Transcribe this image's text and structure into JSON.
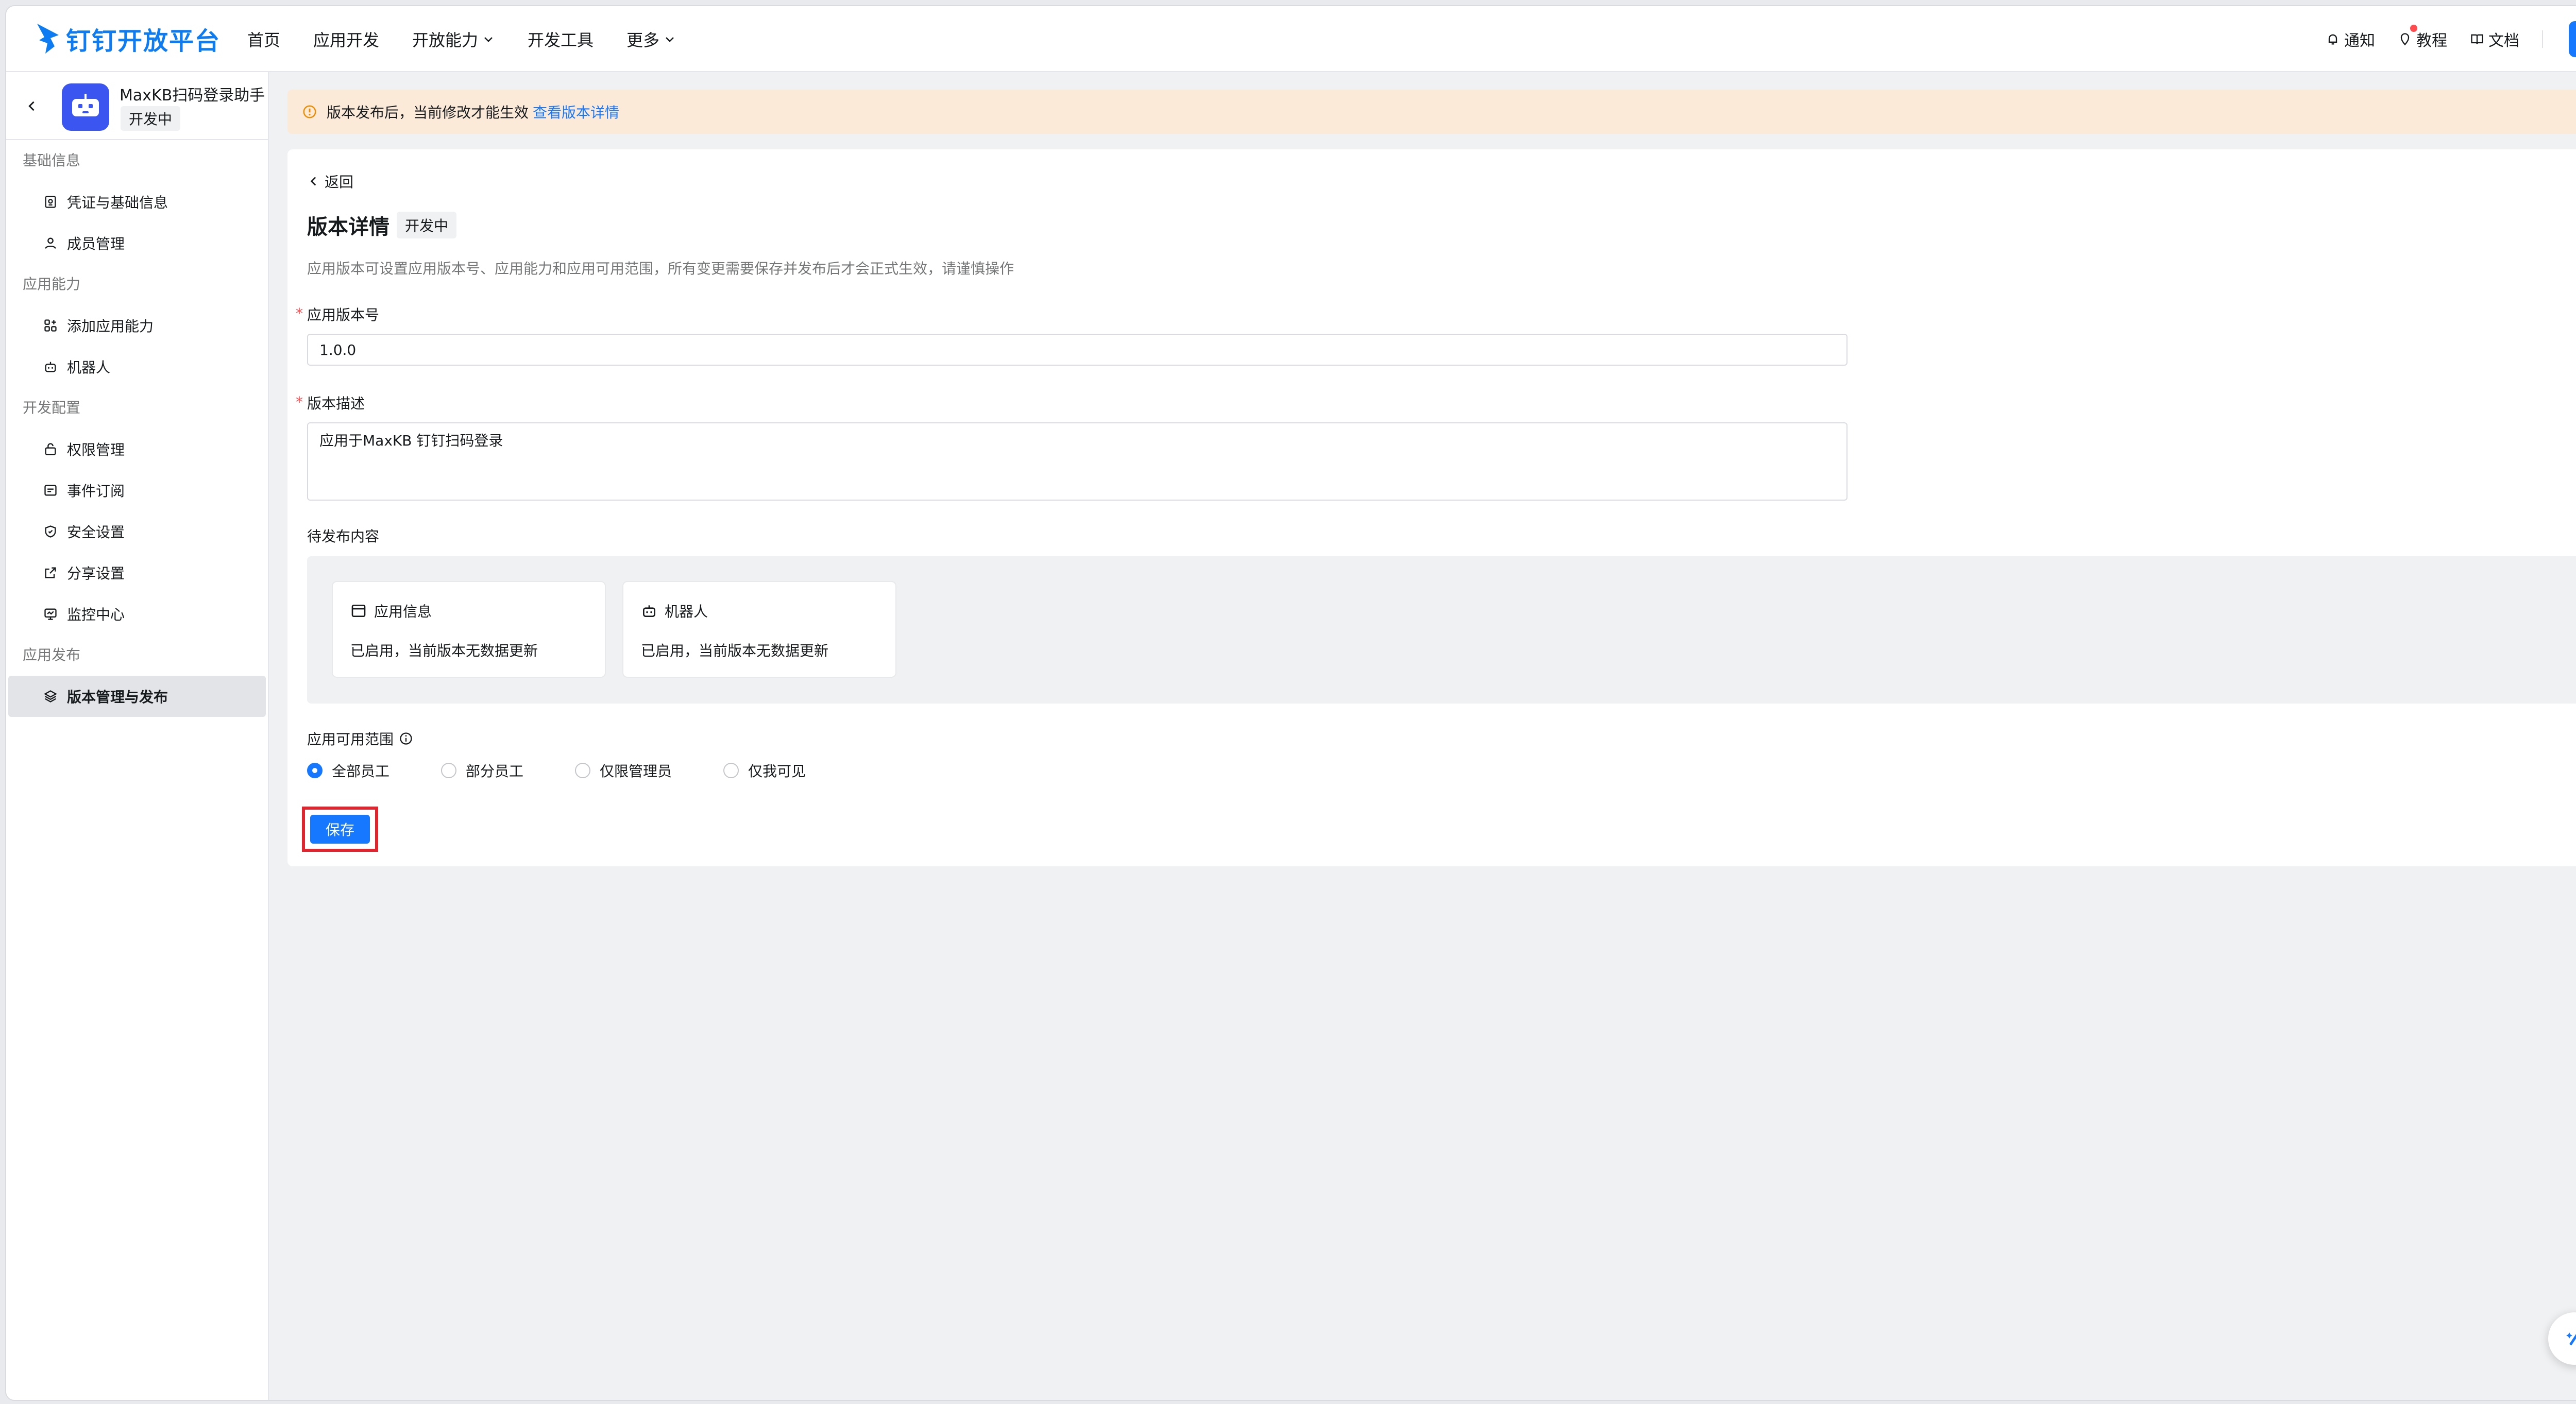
{
  "brand": {
    "name": "钉钉开放平台",
    "color": "#0d7cf2"
  },
  "nav": {
    "items": [
      {
        "label": "首页"
      },
      {
        "label": "应用开发"
      },
      {
        "label": "开放能力"
      },
      {
        "label": "开发工具"
      },
      {
        "label": "更多"
      }
    ],
    "right": {
      "notify": "通知",
      "tutorial": "教程",
      "docs": "文档"
    }
  },
  "app": {
    "name": "MaxKB扫码登录助手",
    "status": "开发中"
  },
  "sidebar": {
    "sections": [
      {
        "title": "基础信息",
        "items": [
          {
            "label": "凭证与基础信息",
            "icon": "credential-icon"
          },
          {
            "label": "成员管理",
            "icon": "user-icon"
          }
        ]
      },
      {
        "title": "应用能力",
        "items": [
          {
            "label": "添加应用能力",
            "icon": "apps-add-icon"
          },
          {
            "label": "机器人",
            "icon": "robot-icon"
          }
        ]
      },
      {
        "title": "开发配置",
        "items": [
          {
            "label": "权限管理",
            "icon": "lock-icon"
          },
          {
            "label": "事件订阅",
            "icon": "event-icon"
          },
          {
            "label": "安全设置",
            "icon": "shield-icon"
          },
          {
            "label": "分享设置",
            "icon": "share-icon"
          },
          {
            "label": "监控中心",
            "icon": "monitor-icon"
          }
        ]
      },
      {
        "title": "应用发布",
        "items": [
          {
            "label": "版本管理与发布",
            "icon": "layers-icon",
            "active": true
          }
        ]
      }
    ]
  },
  "banner": {
    "text": "版本发布后，当前修改才能生效",
    "link": "查看版本详情"
  },
  "detail": {
    "back": "返回",
    "title": "版本详情",
    "status": "开发中",
    "description": "应用版本可设置应用版本号、应用能力和应用可用范围，所有变更需要保存并发布后才会正式生效，请谨慎操作",
    "version_label": "应用版本号",
    "version_value": "1.0.0",
    "desc_label": "版本描述",
    "desc_value": "应用于MaxKB 钉钉扫码登录",
    "pending_label": "待发布内容",
    "pending": [
      {
        "title": "应用信息",
        "icon": "app-window-icon",
        "note": "已启用，当前版本无数据更新"
      },
      {
        "title": "机器人",
        "icon": "robot-icon",
        "note": "已启用，当前版本无数据更新"
      }
    ],
    "scope_label": "应用可用范围",
    "scope_options": [
      {
        "label": "全部员工",
        "selected": true
      },
      {
        "label": "部分员工",
        "selected": false
      },
      {
        "label": "仅限管理员",
        "selected": false
      },
      {
        "label": "仅我可见",
        "selected": false
      }
    ],
    "save": "保存"
  }
}
